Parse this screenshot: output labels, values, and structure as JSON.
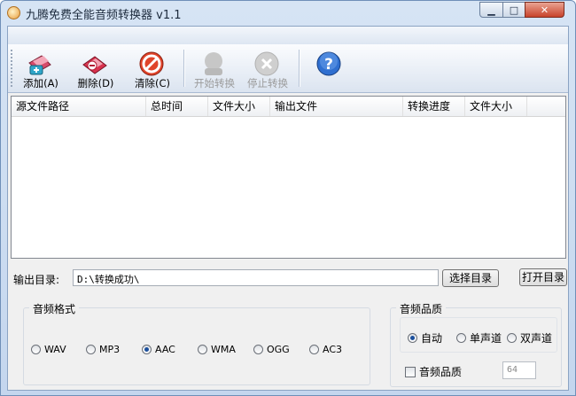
{
  "window": {
    "title": "九腾免费全能音频转换器 v1.1",
    "controls": {
      "minimize": "▁",
      "maximize": "□",
      "close": "✕"
    }
  },
  "toolbar": {
    "buttons": [
      {
        "label": "添加(A)",
        "icon": "add-audio-icon",
        "enabled": true
      },
      {
        "label": "删除(D)",
        "icon": "delete-audio-icon",
        "enabled": true
      },
      {
        "label": "清除(C)",
        "icon": "clear-icon",
        "enabled": true
      },
      {
        "label": "开始转换",
        "icon": "start-convert-icon",
        "enabled": false
      },
      {
        "label": "停止转换",
        "icon": "stop-convert-icon",
        "enabled": false
      },
      {
        "label": "",
        "icon": "help-icon",
        "enabled": true
      }
    ]
  },
  "file_list": {
    "columns": [
      "源文件路径",
      "总时间",
      "文件大小",
      "输出文件",
      "转换进度",
      "文件大小"
    ],
    "rows": []
  },
  "output": {
    "label": "输出目录:",
    "path": "D:\\转换成功\\",
    "choose_button": "选择目录",
    "open_button": "打开目录"
  },
  "audio_format": {
    "title": "音频格式",
    "options": [
      "WAV",
      "MP3",
      "AAC",
      "WMA",
      "OGG",
      "AC3"
    ],
    "selected": "AAC"
  },
  "audio_quality": {
    "title": "音频品质",
    "channel_options": [
      "自动",
      "单声道",
      "双声道"
    ],
    "selected": "自动",
    "quality_checkbox": "音频品质",
    "quality_checked": false,
    "quality_value": "64"
  },
  "colors": {
    "accent": "#1b4f9c",
    "titlebar": "#c4d6ee",
    "close": "#c8432a"
  }
}
